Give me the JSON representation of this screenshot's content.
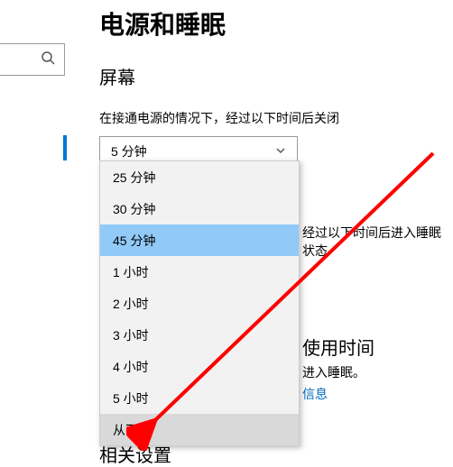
{
  "page": {
    "title": "电源和睡眠"
  },
  "screen": {
    "heading": "屏幕",
    "plugged_label": "在接通电源的情况下，经过以下时间后关闭",
    "select_value": "5 分钟"
  },
  "dropdown": {
    "options": [
      "25 分钟",
      "30 分钟",
      "45 分钟",
      "1 小时",
      "2 小时",
      "3 小时",
      "4 小时",
      "5 小时",
      "从不"
    ],
    "selected_index": 2,
    "hover_index": 8
  },
  "sleep_hint": "经过以下时间后进入睡眠状态",
  "usage": {
    "heading": "使用时间",
    "desc": "进入睡眠。",
    "link": "信息"
  },
  "related": {
    "heading": "相关设置"
  }
}
